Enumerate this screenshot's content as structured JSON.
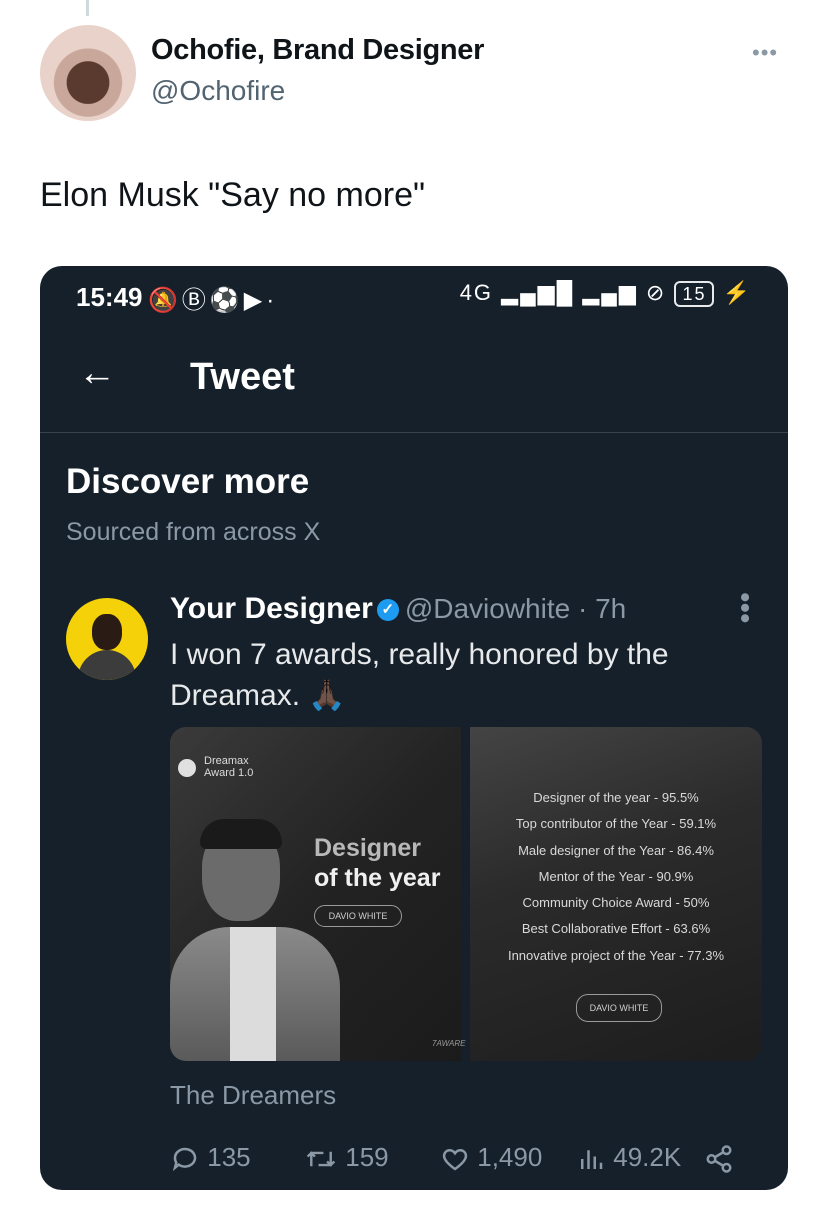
{
  "author": {
    "name": "Ochofie, Brand Designer",
    "handle": "@Ochofire",
    "more_icon": "more-horizontal-icon"
  },
  "tweet": {
    "text": "Elon Musk \"Say no more\""
  },
  "screenshot": {
    "status_bar": {
      "time": "15:49",
      "battery": "15",
      "network": "4G"
    },
    "nav": {
      "title": "Tweet"
    },
    "discover": {
      "title": "Discover more",
      "subtitle": "Sourced from across X"
    },
    "inner_tweet": {
      "name": "Your Designer",
      "handle_time": "@Daviowhite · 7h",
      "text": "I won 7 awards, really honored by the Dreamax. 🙏🏿",
      "media": {
        "brand": "Dreamax\nAward 1.0",
        "award_title_line1": "Designer",
        "award_title_line2": "of the year",
        "name_pill": "DAVIO WHITE",
        "corner_mark": "7AWARE",
        "awards": [
          "Designer of the year - 95.5%",
          "Top contributor of the Year - 59.1%",
          "Male designer of the Year - 86.4%",
          "Mentor of the Year - 90.9%",
          "Community Choice Award - 50%",
          "Best Collaborative Effort - 63.6%",
          "Innovative project of the Year - 77.3%"
        ],
        "name_pill_right": "DAVIO WHITE"
      },
      "source": "The Dreamers",
      "actions": {
        "replies": "135",
        "retweets": "159",
        "likes": "1,490",
        "views": "49.2K"
      }
    }
  },
  "colors": {
    "dark_bg": "#15202b",
    "muted": "#8b98a5",
    "verified": "#1d9bf0",
    "avatar_ring": "#f5d10a"
  }
}
